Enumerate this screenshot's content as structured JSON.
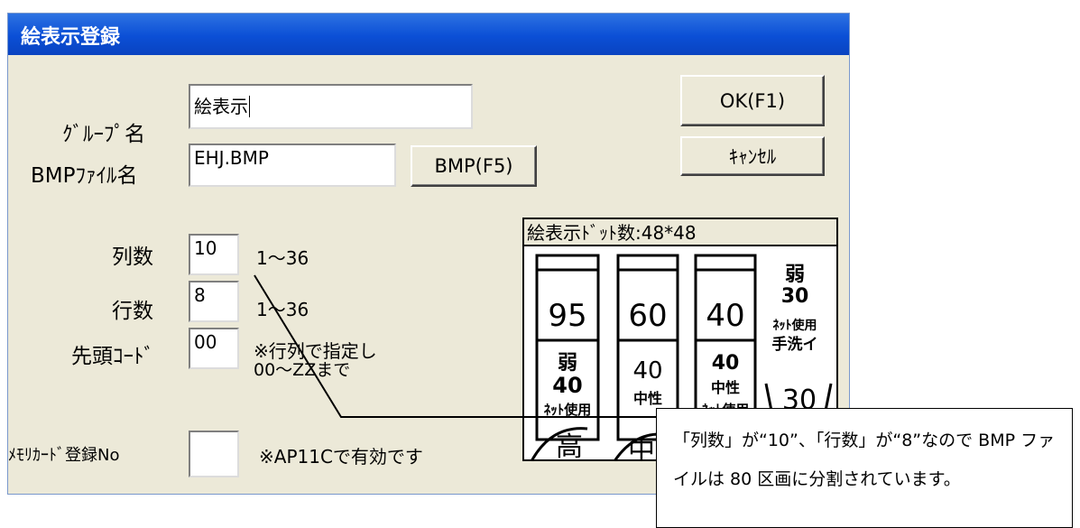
{
  "dialog": {
    "title": "絵表示登録",
    "group_label": "ｸﾞﾙｰﾌﾟ名",
    "group_value": "絵表示",
    "bmp_label": "BMPﾌｧｲﾙ名",
    "bmp_value": "EHJ.BMP",
    "bmp_button": "BMP(F5)",
    "ok_button": "OK(F1)",
    "cancel_button": "ｷｬﾝｾﾙ",
    "cols_label": "列数",
    "cols_value": "10",
    "cols_range": "1～36",
    "rows_label": "行数",
    "rows_value": "8",
    "rows_range": "1～36",
    "code_label": "先頭ｺｰﾄﾞ",
    "code_value": "00",
    "code_note_1": "※行列で指定し",
    "code_note_2": "00～ZZまで",
    "card_label": "ﾒﾓﾘｶｰﾄﾞ登録No",
    "card_value": "",
    "card_note": "※AP11Cで有効です"
  },
  "preview": {
    "title": "絵表示ﾄﾞｯﾄ数:48*48",
    "temps_row1": [
      "95",
      "60",
      "40"
    ],
    "weak30": [
      "弱",
      "30"
    ],
    "net_use_hand": "ﾈｯﾄ使用",
    "hand_wash": "手洗イ",
    "hand30": "30",
    "row2_top": [
      "弱",
      "40",
      "40"
    ],
    "row2_bottom": [
      "40",
      "中性",
      "中性"
    ],
    "net_use": "ﾈｯﾄ使用",
    "iron_high": "高",
    "iron_mid": "中"
  },
  "callout": {
    "line1": "「列数」が“10”、「行数」が“8”なので BMP ファ",
    "line2": "イルは 80 区画に分割されています。"
  }
}
